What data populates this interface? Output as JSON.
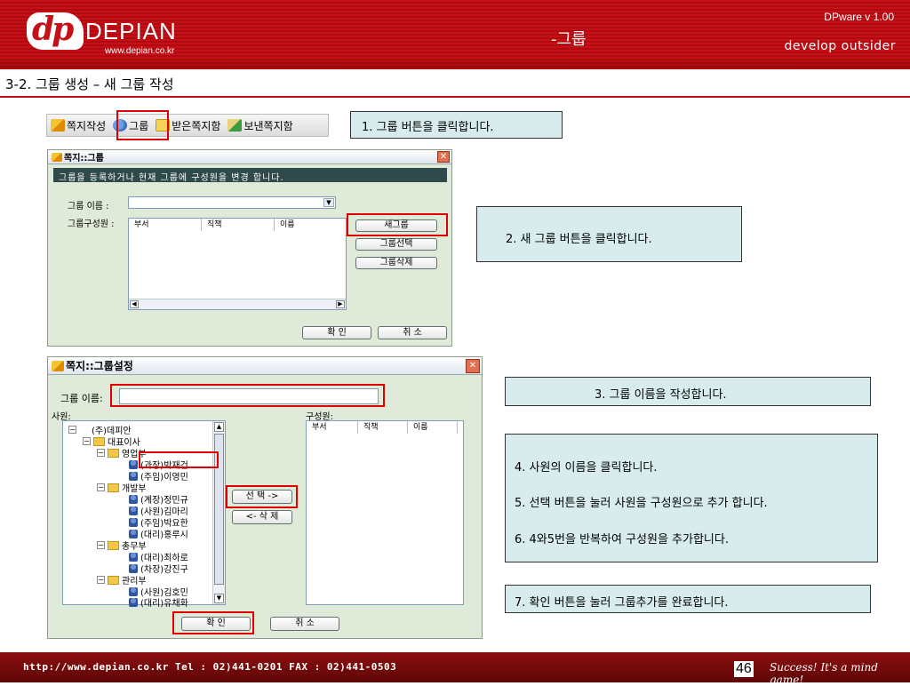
{
  "header": {
    "logo_mark": "dp",
    "logo_name": "DEPIAN",
    "logo_url": "www.depian.co.kr",
    "title": "-그룹",
    "version": "DPware v 1.00",
    "tagline": "develop outsider"
  },
  "section_title": "3-2. 그룹 생성 – 새 그룹 작성",
  "toolbar": {
    "items": [
      "쪽지작성",
      "그룹",
      "받은쪽지함",
      "보낸쪽지함"
    ]
  },
  "callouts": {
    "step1": "1. 그룹 버튼을 클릭합니다.",
    "step2": "2. 새 그룹 버튼을 클릭합니다.",
    "step3": "3. 그룹 이름을 작성합니다.",
    "step4": "4. 사원의 이름을 클릭합니다.",
    "step5": "5. 선택 버튼을 눌러 사원을 구성원으로 추가 합니다.",
    "step6": "6. 4와5번을 반복하여 구성원을 추가합니다.",
    "step7": "7. 확인 버튼을 눌러 그룹추가를 완료합니다."
  },
  "dialog1": {
    "title": "쪽지::그룹",
    "banner": "그룹을 등록하거나 현재 그룹에 구성원을 변경 합니다.",
    "group_name_label": "그룹 이름 :",
    "members_label": "그룹구성원 :",
    "columns": [
      "부서",
      "직책",
      "이름"
    ],
    "buttons": {
      "new_group": "새그룹",
      "select_group": "그룹선택",
      "delete_group": "그룹삭제",
      "ok": "확 인",
      "cancel": "취 소"
    },
    "close": "✕"
  },
  "dialog2": {
    "title": "쪽지::그룹설정",
    "group_name_label": "그룹 이름:",
    "employees_label": "사원:",
    "members_label": "구성원:",
    "columns": [
      "부서",
      "직책",
      "이름"
    ],
    "tree": [
      "(주)데피안",
      "대표이사",
      "영업부",
      "(과장)박재건",
      "(주임)이영민",
      "개발부",
      "(계장)정민규",
      "(사원)김마리",
      "(주임)박요한",
      "(대리)홍루시",
      "총무부",
      "(대리)최하로",
      "(차장)강진구",
      "관리부",
      "(사원)김호민",
      "(대리)유채화"
    ],
    "buttons": {
      "select": "선 택 ->",
      "delete": "<- 삭 제",
      "ok": "확 인",
      "cancel": "취 소"
    },
    "close": "✕"
  },
  "footer": {
    "text": "http://www.depian.co.kr   Tel : 02)441-0201   FAX : 02)441-0503",
    "page": "46",
    "slogan": "Success! It's a mind game!"
  }
}
